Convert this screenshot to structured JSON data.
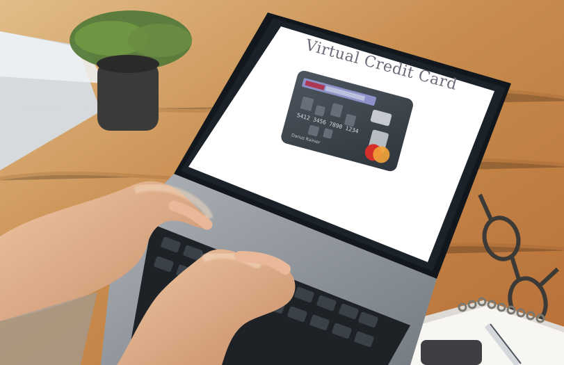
{
  "screen": {
    "title": "Virtual Credit Card"
  },
  "card": {
    "number": "5412 3456 7890 1234",
    "holder": "Darius Rainier",
    "network_logo": "mastercard-logo"
  },
  "colors": {
    "table_wood": "#c89257",
    "laptop_body": "#8f959b",
    "screen_bg": "#ffffff",
    "card_base": "#3f474f",
    "mastercard_red": "#d42f2a",
    "mastercard_yellow": "#f2a33a"
  }
}
